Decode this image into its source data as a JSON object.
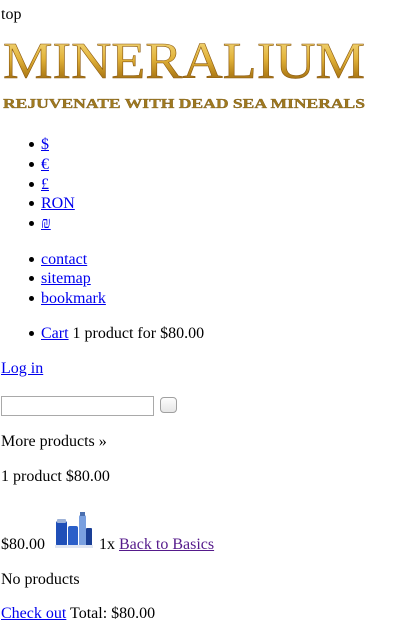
{
  "top_label": "top",
  "logo": {
    "title": "MINERALIUM",
    "tagline": "REJUVENATE WITH DEAD SEA MINERALS",
    "gold_light": "#f3d36b",
    "gold_dark": "#8c5a10",
    "tagline_color": "#9c7a1e"
  },
  "currencies": [
    "$",
    "€",
    "£",
    "RON",
    "₪"
  ],
  "links": [
    "contact",
    "sitemap",
    "bookmark"
  ],
  "cart": {
    "link": "Cart",
    "summary": "1 product for $80.00"
  },
  "login": "Log in",
  "search": {
    "value": "",
    "placeholder": ""
  },
  "more_products": "More products »",
  "cart_block": {
    "summary": "1 product $80.00",
    "item": {
      "price": "$80.00",
      "qty": "1x",
      "name": "Back to Basics"
    },
    "no_products": "No products",
    "checkout": "Check out",
    "total": "Total: $80.00"
  }
}
